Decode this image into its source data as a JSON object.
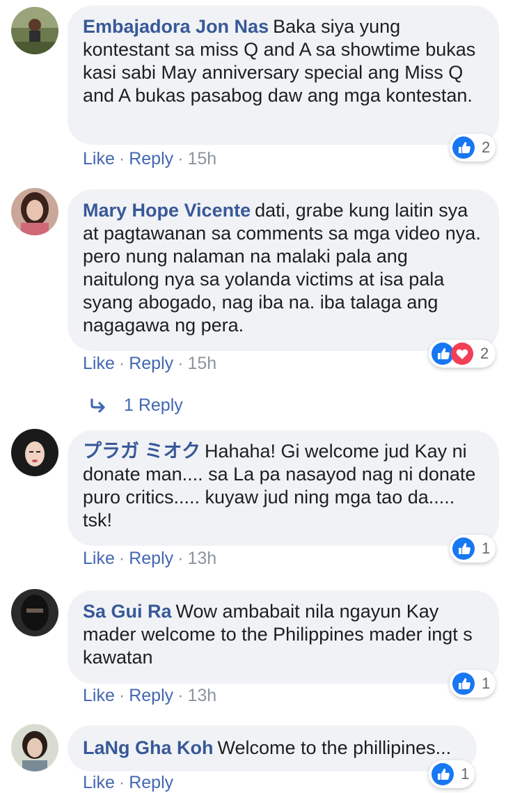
{
  "comments": [
    {
      "author": "Embajadora Jon Nas",
      "text": "Baka siya yung kontestant sa miss Q and A sa showtime bukas kasi sabi May anniversary special ang Miss Q and A bukas pasabog daw ang mga kontestan.",
      "like_label": "Like",
      "reply_label": "Reply",
      "time": "15h",
      "reaction_count": "2",
      "reactions": [
        "like-icon"
      ]
    },
    {
      "author": "Mary Hope Vicente",
      "text": "dati, grabe kung laitin sya at pagtawanan sa comments sa mga video nya. pero nung nalaman na malaki pala ang naitulong nya sa yolanda victims at isa pala syang abogado, nag iba na. iba talaga ang nagagawa ng pera.",
      "like_label": "Like",
      "reply_label": "Reply",
      "time": "15h",
      "reaction_count": "2",
      "reactions": [
        "like-icon",
        "love-icon"
      ]
    },
    {
      "author": "プラガ ミオク",
      "text": "Hahaha! Gi welcome jud Kay ni donate man.... sa La pa nasayod nag ni donate puro critics..... kuyaw jud ning mga tao da..... tsk!",
      "like_label": "Like",
      "reply_label": "Reply",
      "time": "13h",
      "reaction_count": "1",
      "reactions": [
        "like-icon"
      ]
    },
    {
      "author": "Sa Gui Ra",
      "text": "Wow ambabait nila ngayun Kay mader welcome to the Philippines mader ingt s kawatan",
      "like_label": "Like",
      "reply_label": "Reply",
      "time": "13h",
      "reaction_count": "1",
      "reactions": [
        "like-icon"
      ]
    },
    {
      "author": "LaNg Gha Koh",
      "text": "Welcome to the phillipines...",
      "like_label": "Like",
      "reply_label": "Reply",
      "time": "",
      "reaction_count": "1",
      "reactions": [
        "like-icon"
      ]
    }
  ],
  "view_replies_label": "1 Reply",
  "colors": {
    "author": "#385898",
    "link": "#4267b2",
    "bubble": "#f0f2f5",
    "like": "#1877f2",
    "love": "#f33e58"
  }
}
